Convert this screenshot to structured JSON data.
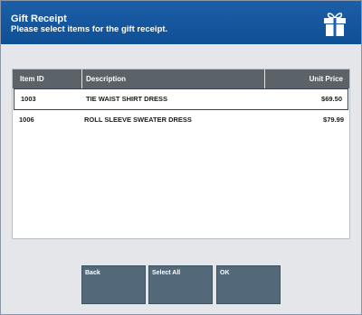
{
  "header": {
    "title": "Gift Receipt",
    "subtitle": "Please select items for the gift receipt.",
    "icon": "gift-icon"
  },
  "table": {
    "columns": [
      "Item ID",
      "Description",
      "Unit Price"
    ],
    "rows": [
      {
        "item_id": "1003",
        "description": "TIE WAIST SHIRT DRESS",
        "unit_price": "$69.50",
        "selected": true
      },
      {
        "item_id": "1006",
        "description": "ROLL SLEEVE SWEATER DRESS",
        "unit_price": "$79.99",
        "selected": false
      }
    ]
  },
  "buttons": {
    "back": "Back",
    "select_all": "Select All",
    "ok": "OK"
  },
  "colors": {
    "header": "#1c5fa6",
    "table_header": "#5b6268",
    "button": "#536879",
    "background": "#e4e6ea"
  }
}
